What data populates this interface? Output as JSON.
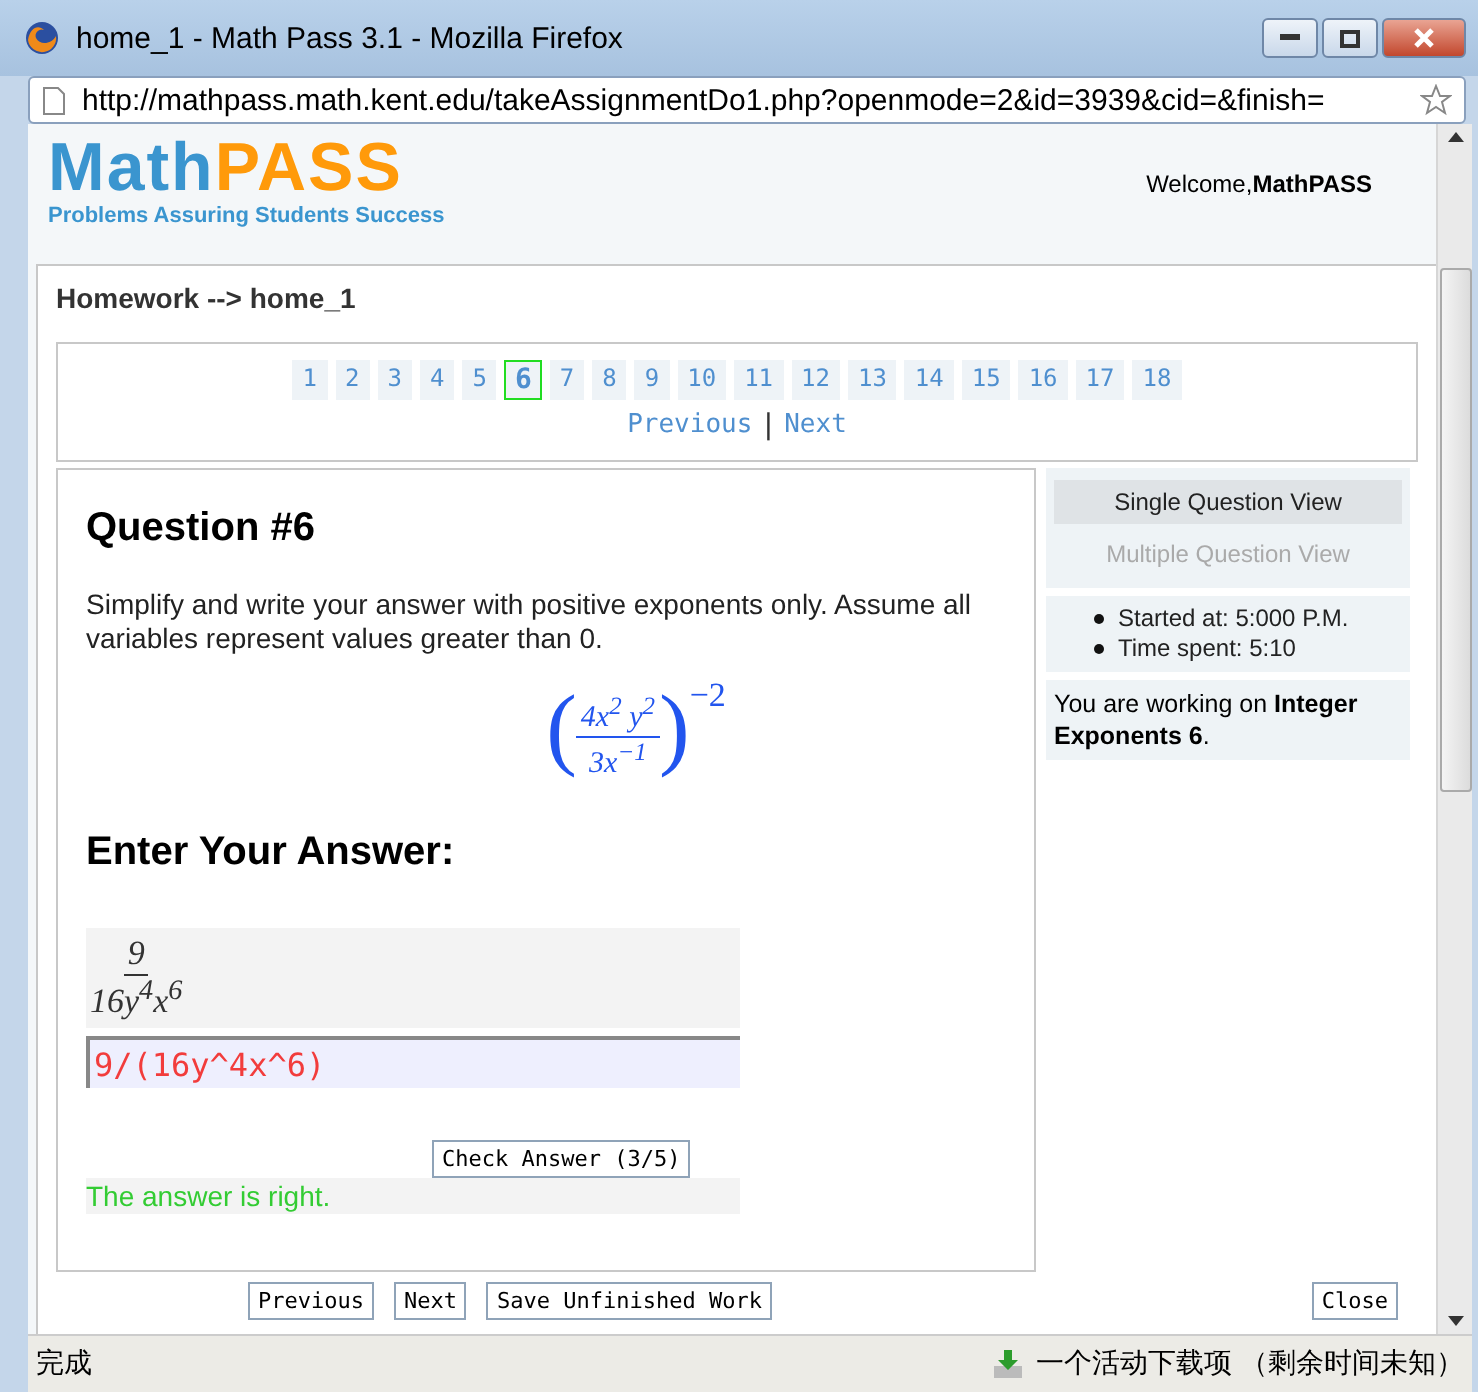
{
  "window": {
    "title": "home_1 - Math Pass 3.1 - Mozilla Firefox"
  },
  "address_bar": {
    "url": "http://mathpass.math.kent.edu/takeAssignmentDo1.php?openmode=2&id=3939&cid=&finish="
  },
  "logo": {
    "word_left": "Math",
    "word_right": "PASS",
    "tagline": "Problems Assuring Students Success"
  },
  "welcome": {
    "label": "Welcome,",
    "user": "MathPASS"
  },
  "breadcrumb": "Homework --> home_1",
  "pages": [
    {
      "label": "1",
      "selected": false
    },
    {
      "label": "2",
      "selected": false
    },
    {
      "label": "3",
      "selected": false
    },
    {
      "label": "4",
      "selected": false
    },
    {
      "label": "5",
      "selected": false
    },
    {
      "label": "6",
      "selected": true
    },
    {
      "label": "7",
      "selected": false
    },
    {
      "label": "8",
      "selected": false
    },
    {
      "label": "9",
      "selected": false
    },
    {
      "label": "10",
      "selected": false
    },
    {
      "label": "11",
      "selected": false
    },
    {
      "label": "12",
      "selected": false
    },
    {
      "label": "13",
      "selected": false
    },
    {
      "label": "14",
      "selected": false
    },
    {
      "label": "15",
      "selected": false
    },
    {
      "label": "16",
      "selected": false
    },
    {
      "label": "17",
      "selected": false
    },
    {
      "label": "18",
      "selected": false
    }
  ],
  "pager_links": {
    "previous": "Previous",
    "separator": "|",
    "next": "Next"
  },
  "question": {
    "title": "Question #6",
    "text": "Simplify and write your answer with positive exponents only. Assume all variables represent values greater than 0.",
    "expression": {
      "open": "(",
      "close": ")",
      "numerator": "4x$^{2}$ y$^{2}$",
      "denominator": "3x$^{−1}$",
      "exponent": "−2"
    }
  },
  "answer": {
    "heading": "Enter Your Answer:",
    "preview": {
      "numerator": "9",
      "denominator": "16y$^{4}$x$^{6}$"
    },
    "value": "9/(16y^4x^6)",
    "check_button": "Check Answer (3/5)",
    "feedback": "The answer is right."
  },
  "sidebar": {
    "views": [
      {
        "label": "Single Question View",
        "selected": true
      },
      {
        "label": "Multiple Question View",
        "selected": false
      }
    ],
    "info": [
      "Started at: 5:000 P.M.",
      "Time spent: 5:10"
    ],
    "working_on": "You are working on **Integer Exponents 6**."
  },
  "buttons": [
    {
      "label": "Previous"
    },
    {
      "label": "Next"
    },
    {
      "label": "Save Unfinished Work"
    }
  ],
  "close_button": "Close",
  "status_bar": {
    "left": "完成",
    "download": "一个活动下载项 （剩余时间未知）"
  }
}
